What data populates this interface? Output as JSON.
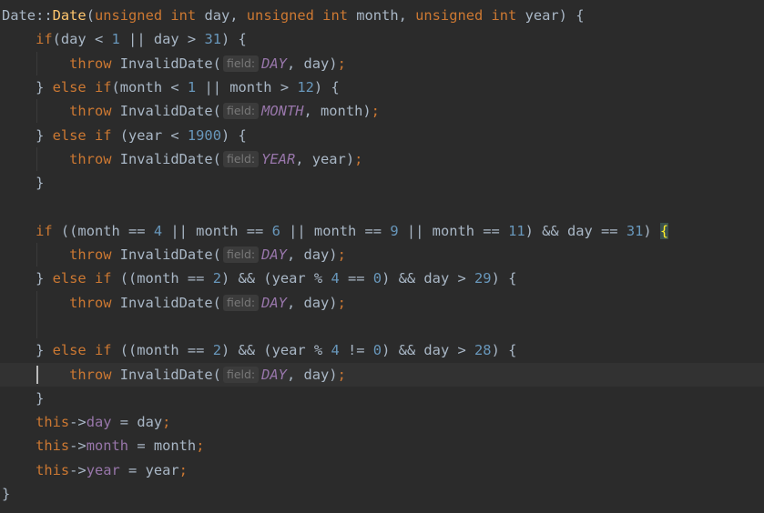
{
  "lines": [
    [
      [
        "Date::",
        "plain"
      ],
      [
        "Date",
        "fn"
      ],
      [
        "(",
        "plain"
      ],
      [
        "unsigned int",
        "kw"
      ],
      [
        " day, ",
        "plain"
      ],
      [
        "unsigned int",
        "kw"
      ],
      [
        " month, ",
        "plain"
      ],
      [
        "unsigned int",
        "kw"
      ],
      [
        " year) {",
        "plain"
      ]
    ],
    [
      [
        "    ",
        "plain"
      ],
      [
        "if",
        "kw"
      ],
      [
        "(day < ",
        "plain"
      ],
      [
        "1",
        "num"
      ],
      [
        " || day > ",
        "plain"
      ],
      [
        "31",
        "num"
      ],
      [
        ") {",
        "plain"
      ]
    ],
    [
      [
        "        ",
        "plain"
      ],
      [
        "throw",
        "kw"
      ],
      [
        " InvalidDate(",
        "plain"
      ],
      [
        "field:",
        "hint"
      ],
      [
        "DAY",
        "ital"
      ],
      [
        ", day)",
        "plain"
      ],
      [
        ";",
        "kw"
      ]
    ],
    [
      [
        "    } ",
        "plain"
      ],
      [
        "else if",
        "kw"
      ],
      [
        "(month < ",
        "plain"
      ],
      [
        "1",
        "num"
      ],
      [
        " || month > ",
        "plain"
      ],
      [
        "12",
        "num"
      ],
      [
        ") {",
        "plain"
      ]
    ],
    [
      [
        "        ",
        "plain"
      ],
      [
        "throw",
        "kw"
      ],
      [
        " InvalidDate(",
        "plain"
      ],
      [
        "field:",
        "hint"
      ],
      [
        "MONTH",
        "ital"
      ],
      [
        ", month)",
        "plain"
      ],
      [
        ";",
        "kw"
      ]
    ],
    [
      [
        "    } ",
        "plain"
      ],
      [
        "else if",
        "kw"
      ],
      [
        " (year < ",
        "plain"
      ],
      [
        "1900",
        "num"
      ],
      [
        ") {",
        "plain"
      ]
    ],
    [
      [
        "        ",
        "plain"
      ],
      [
        "throw",
        "kw"
      ],
      [
        " InvalidDate(",
        "plain"
      ],
      [
        "field:",
        "hint"
      ],
      [
        "YEAR",
        "ital"
      ],
      [
        ", year)",
        "plain"
      ],
      [
        ";",
        "kw"
      ]
    ],
    [
      [
        "    }",
        "plain"
      ]
    ],
    [],
    [
      [
        "    ",
        "plain"
      ],
      [
        "if",
        "kw"
      ],
      [
        " ((month == ",
        "plain"
      ],
      [
        "4",
        "num"
      ],
      [
        " || month == ",
        "plain"
      ],
      [
        "6",
        "num"
      ],
      [
        " || month == ",
        "plain"
      ],
      [
        "9",
        "num"
      ],
      [
        " || month == ",
        "plain"
      ],
      [
        "11",
        "num"
      ],
      [
        ") && day == ",
        "plain"
      ],
      [
        "31",
        "num"
      ],
      [
        ") ",
        "plain"
      ],
      [
        "{",
        "bracehl"
      ]
    ],
    [
      [
        "        ",
        "plain"
      ],
      [
        "throw",
        "kw"
      ],
      [
        " InvalidDate(",
        "plain"
      ],
      [
        "field:",
        "hint"
      ],
      [
        "DAY",
        "ital"
      ],
      [
        ", day)",
        "plain"
      ],
      [
        ";",
        "kw"
      ]
    ],
    [
      [
        "    } ",
        "plain"
      ],
      [
        "else if",
        "kw"
      ],
      [
        " ((month == ",
        "plain"
      ],
      [
        "2",
        "num"
      ],
      [
        ") && (year % ",
        "plain"
      ],
      [
        "4",
        "num"
      ],
      [
        " == ",
        "plain"
      ],
      [
        "0",
        "num"
      ],
      [
        ") && day > ",
        "plain"
      ],
      [
        "29",
        "num"
      ],
      [
        ") {",
        "plain"
      ]
    ],
    [
      [
        "        ",
        "plain"
      ],
      [
        "throw",
        "kw"
      ],
      [
        " InvalidDate(",
        "plain"
      ],
      [
        "field:",
        "hint"
      ],
      [
        "DAY",
        "ital"
      ],
      [
        ", day)",
        "plain"
      ],
      [
        ";",
        "kw"
      ]
    ],
    [],
    [
      [
        "    } ",
        "plain"
      ],
      [
        "else if",
        "kw"
      ],
      [
        " ((month == ",
        "plain"
      ],
      [
        "2",
        "num"
      ],
      [
        ") && (year % ",
        "plain"
      ],
      [
        "4",
        "num"
      ],
      [
        " != ",
        "plain"
      ],
      [
        "0",
        "num"
      ],
      [
        ") && day > ",
        "plain"
      ],
      [
        "28",
        "num"
      ],
      [
        ") {",
        "plain"
      ]
    ],
    [
      [
        "        ",
        "plain"
      ],
      [
        "throw",
        "kw"
      ],
      [
        " InvalidDate(",
        "plain"
      ],
      [
        "field:",
        "hint"
      ],
      [
        "DAY",
        "ital"
      ],
      [
        ", day)",
        "plain"
      ],
      [
        ";",
        "kw"
      ]
    ],
    [
      [
        "    }",
        "plain"
      ]
    ],
    [
      [
        "    ",
        "plain"
      ],
      [
        "this",
        "kw"
      ],
      [
        "->",
        "plain"
      ],
      [
        "day",
        "fld"
      ],
      [
        " = day",
        "plain"
      ],
      [
        ";",
        "kw"
      ]
    ],
    [
      [
        "    ",
        "plain"
      ],
      [
        "this",
        "kw"
      ],
      [
        "->",
        "plain"
      ],
      [
        "month",
        "fld"
      ],
      [
        " = month",
        "plain"
      ],
      [
        ";",
        "kw"
      ]
    ],
    [
      [
        "    ",
        "plain"
      ],
      [
        "this",
        "kw"
      ],
      [
        "->",
        "plain"
      ],
      [
        "year",
        "fld"
      ],
      [
        " = year",
        "plain"
      ],
      [
        ";",
        "kw"
      ]
    ],
    [
      [
        "}",
        "plain"
      ]
    ]
  ],
  "current_line": 15
}
